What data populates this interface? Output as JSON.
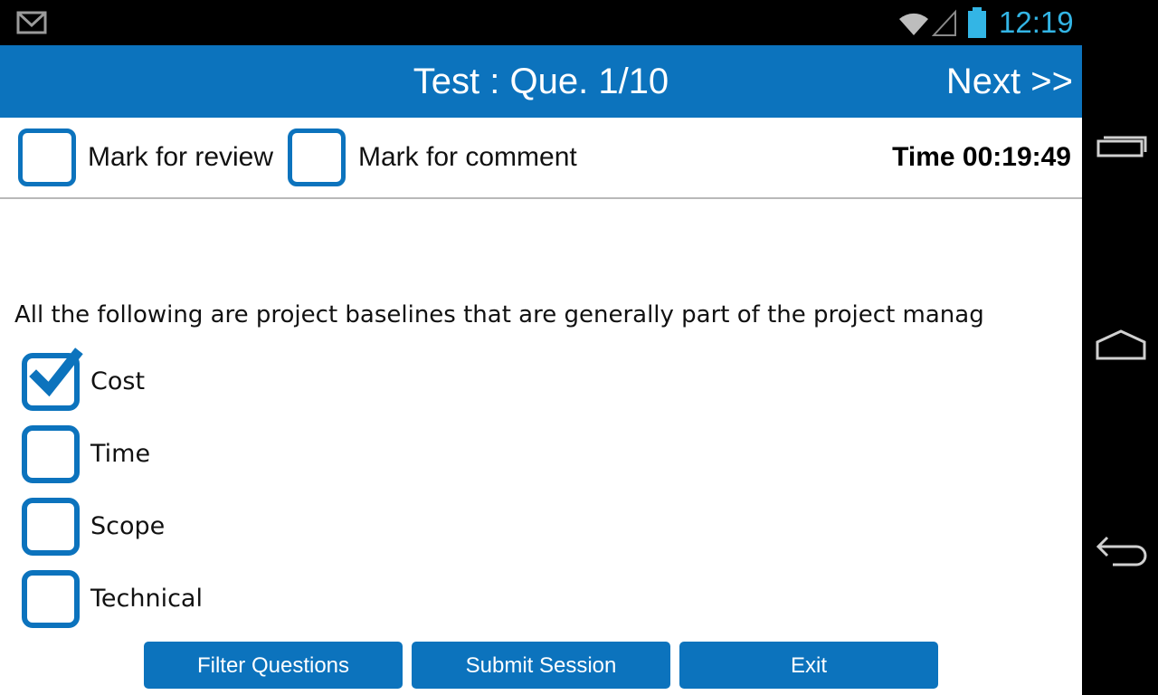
{
  "status_bar": {
    "time": "12:19",
    "accent_color": "#33b5e5",
    "icons": [
      "gmail-icon",
      "wifi-icon",
      "signal-icon",
      "battery-icon"
    ]
  },
  "header": {
    "title": "Test : Que. 1/10",
    "next_label": "Next >>",
    "color": "#0c73bd"
  },
  "toolbar": {
    "review_label": "Mark for review",
    "comment_label": "Mark for comment",
    "review_checked": false,
    "comment_checked": false,
    "timer": "Time 00:19:49"
  },
  "question": {
    "text": "All the following are project baselines that are generally part of the project manag",
    "options": [
      {
        "label": "Cost",
        "checked": true
      },
      {
        "label": "Time",
        "checked": false
      },
      {
        "label": "Scope",
        "checked": false
      },
      {
        "label": "Technical",
        "checked": false
      }
    ]
  },
  "buttons": {
    "filter": "Filter Questions",
    "submit": "Submit Session",
    "exit": "Exit"
  },
  "nav_bar": {
    "icons": [
      "recent-apps-icon",
      "home-icon",
      "back-icon"
    ]
  }
}
